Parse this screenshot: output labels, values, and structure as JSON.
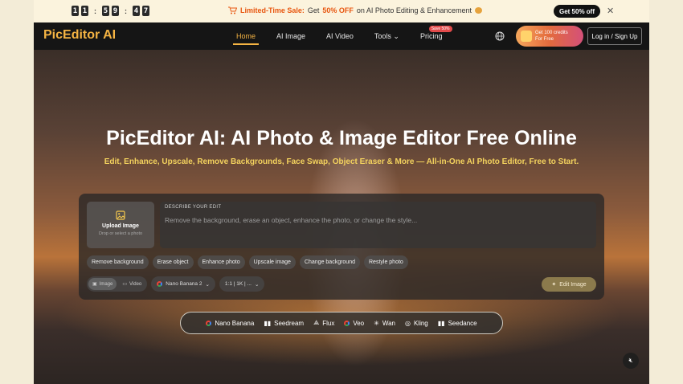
{
  "promo": {
    "timer": [
      "1",
      "1",
      "5",
      "9",
      "4",
      "7"
    ],
    "text_prefix": "Limited-Time Sale:",
    "text_mid": "Get",
    "text_off": "50% OFF",
    "text_suffix": "on AI Photo Editing & Enhancement",
    "button": "Get 50% off",
    "close": "✕"
  },
  "header": {
    "logo": "PicEditor AI",
    "nav": [
      {
        "label": "Home",
        "active": true
      },
      {
        "label": "AI Image"
      },
      {
        "label": "AI Video"
      },
      {
        "label": "Tools ⌄"
      },
      {
        "label": "Pricing",
        "badge": "Save 50%"
      }
    ],
    "credits_line1": "Get 100 credits",
    "credits_line2": "For Free",
    "login": "Log in / Sign Up"
  },
  "hero": {
    "title_part1": "PicEditor AI",
    "title_part2": ": AI Photo & Image Editor Free Online",
    "subtitle": "Edit, Enhance, Upscale, Remove Backgrounds, Face Swap, Object Eraser & More — All-in-One AI Photo Editor, Free to Start."
  },
  "editor": {
    "upload_title": "Upload Image",
    "upload_sub": "Drop or select a photo",
    "describe_label": "DESCRIBE YOUR EDIT",
    "placeholder": "Remove the background, erase an object, enhance the photo, or change the style...",
    "chips": [
      "Remove background",
      "Erase object",
      "Enhance photo",
      "Upscale image",
      "Change background",
      "Restyle photo"
    ],
    "mode_image": "Image",
    "mode_video": "Video",
    "model": "Nano Banana 2",
    "ratio": "1:1 | 1K | ...",
    "edit_button": "Edit Image"
  },
  "models": [
    "Nano Banana",
    "Seedream",
    "Flux",
    "Veo",
    "Wan",
    "Kling",
    "Seedance"
  ],
  "colors": {
    "accent": "#f5b443",
    "title_accent": "#f5c84e",
    "promo_orange": "#e8560f"
  }
}
